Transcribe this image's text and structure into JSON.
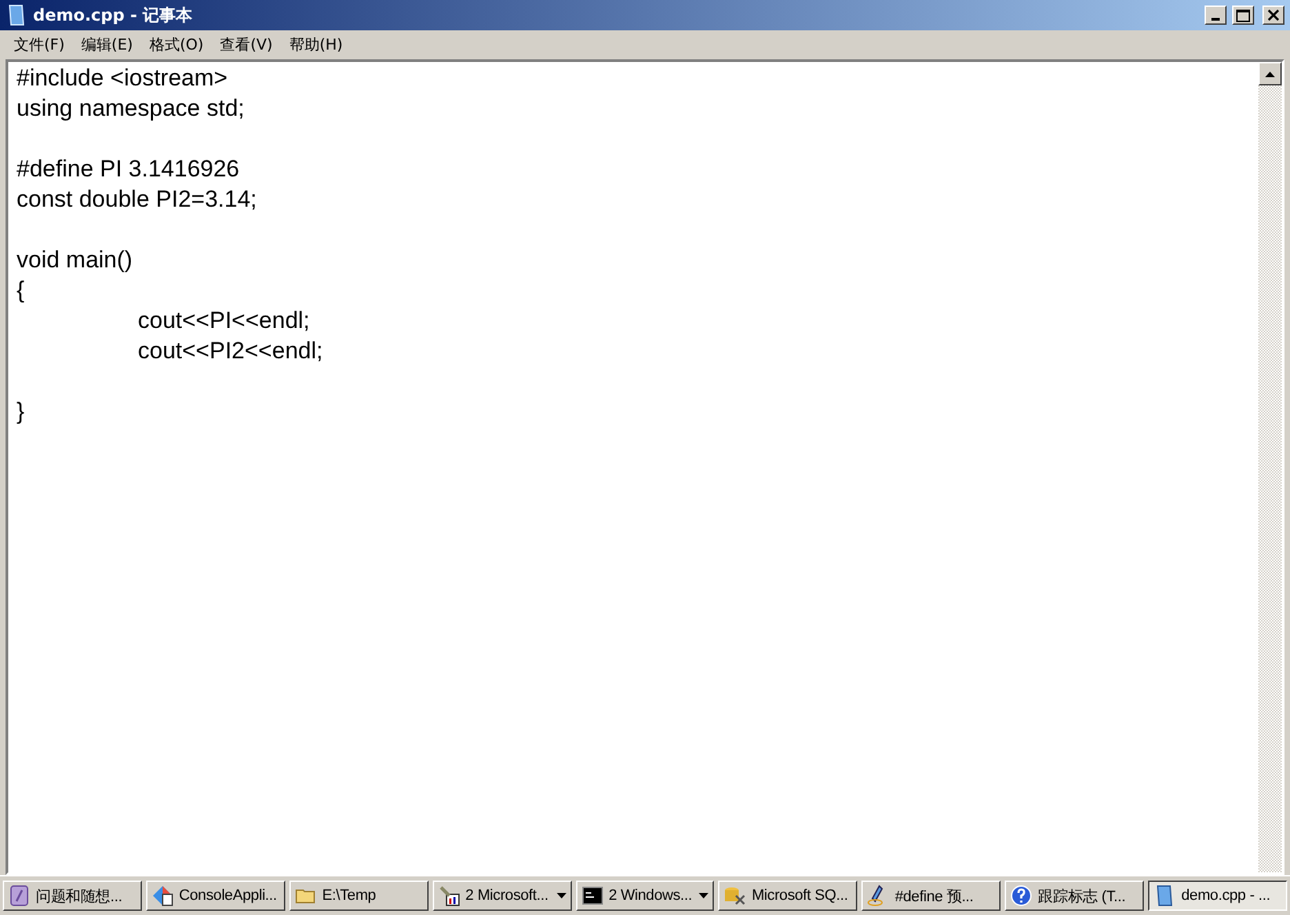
{
  "window": {
    "title": "demo.cpp - 记事本"
  },
  "menu": [
    {
      "label": "文件(F)"
    },
    {
      "label": "编辑(E)"
    },
    {
      "label": "格式(O)"
    },
    {
      "label": "查看(V)"
    },
    {
      "label": "帮助(H)"
    }
  ],
  "editor": {
    "text": "#include <iostream>\nusing namespace std;\n\n#define PI 3.1416926\nconst double PI2=3.14;\n\nvoid main()\n{\n\tcout<<PI<<endl;\n\tcout<<PI2<<endl;\n\n}"
  },
  "taskbar": [
    {
      "label": "问题和随想...",
      "selected": false,
      "has_menu": false
    },
    {
      "label": "ConsoleAppli...",
      "selected": false,
      "has_menu": false
    },
    {
      "label": "E:\\Temp",
      "selected": false,
      "has_menu": false
    },
    {
      "label": "2 Microsoft...",
      "selected": false,
      "has_menu": true
    },
    {
      "label": "2 Windows...",
      "selected": false,
      "has_menu": true
    },
    {
      "label": "Microsoft SQ...",
      "selected": false,
      "has_menu": false
    },
    {
      "label": "#define 预...",
      "selected": false,
      "has_menu": false
    },
    {
      "label": "跟踪标志 (T...",
      "selected": false,
      "has_menu": false
    },
    {
      "label": "demo.cpp - ...",
      "selected": true,
      "has_menu": false
    }
  ]
}
